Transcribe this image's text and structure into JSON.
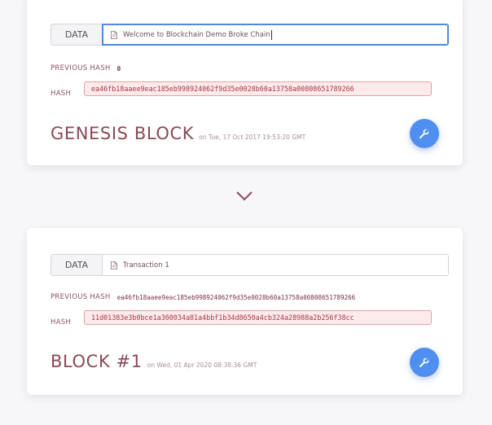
{
  "blocks": [
    {
      "data_label": "DATA",
      "data_value": "Welcome to Blockchain Demo Broke Chain",
      "previous_hash_label": "PREVIOUS HASH",
      "previous_hash": "0",
      "hash_label": "HASH",
      "hash": "ea46fb18aaee9eac185eb998924062f9d35e0028b60a13758a00808651789266",
      "title": "GENESIS BLOCK",
      "timestamp": "on Tue, 17 Oct 2017 19:53:20 GMT",
      "fab_icon": "wrench-icon"
    },
    {
      "data_label": "DATA",
      "data_value": "Transaction 1",
      "previous_hash_label": "PREVIOUS HASH",
      "previous_hash": "ea46fb18aaee9eac185eb998924062f9d35e0028b60a13758a00808651789266",
      "hash_label": "HASH",
      "hash": "11d01383e3b0bce1a360034a81a4bbf1b34d8650a4cb324a28988a2b256f38cc",
      "title": "BLOCK #1",
      "timestamp": "on Wed, 01 Apr 2020 08:38:36 GMT",
      "fab_icon": "wrench-icon"
    }
  ],
  "connector_icon": "chevron-down-icon",
  "colors": {
    "accent": "#8a4a57",
    "fab": "#4f8ff0",
    "hash_bg": "#fdeaea",
    "hash_border": "#e7a1a5",
    "focus": "#4a8be0"
  }
}
